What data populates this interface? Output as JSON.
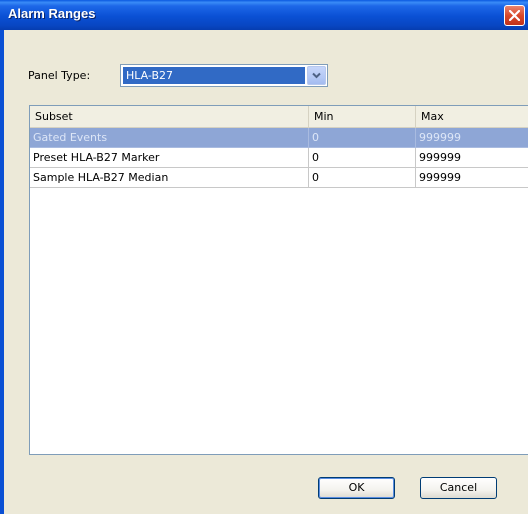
{
  "window": {
    "title": "Alarm Ranges"
  },
  "panel_type": {
    "label": "Panel Type:",
    "value": "HLA-B27"
  },
  "table": {
    "columns": [
      "Subset",
      "Min",
      "Max"
    ],
    "rows": [
      {
        "subset": "Gated Events",
        "min": "0",
        "max": "999999",
        "selected": true
      },
      {
        "subset": "Preset HLA-B27 Marker",
        "min": "0",
        "max": "999999",
        "selected": false
      },
      {
        "subset": "Sample HLA-B27 Median",
        "min": "0",
        "max": "999999",
        "selected": false
      }
    ]
  },
  "buttons": {
    "ok": "OK",
    "cancel": "Cancel"
  },
  "icons": {
    "close": "close-icon",
    "dropdown": "chevron-down-icon"
  },
  "colors": {
    "title_bar": "#0a50d4",
    "selection": "#316ac5",
    "selected_row": "#8ea6d6"
  }
}
